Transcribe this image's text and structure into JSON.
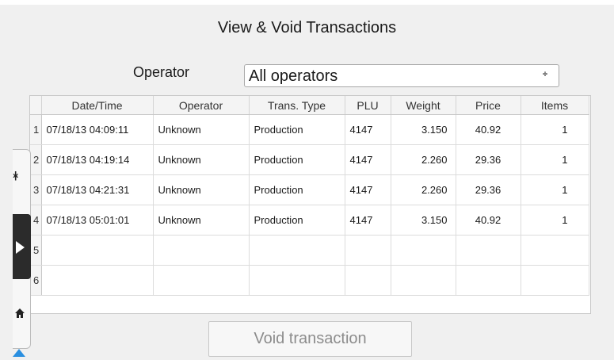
{
  "title": "View & Void Transactions",
  "operator_filter": {
    "label": "Operator",
    "selected": "All operators"
  },
  "table": {
    "columns": [
      "",
      "Date/Time",
      "Operator",
      "Trans. Type",
      "PLU",
      "Weight",
      "Price",
      "Items"
    ],
    "rows": [
      {
        "num": "1",
        "datetime": "07/18/13 04:09:11",
        "operator": "Unknown",
        "type": "Production",
        "plu": "4147",
        "weight": "3.150",
        "price": "40.92",
        "items": "1"
      },
      {
        "num": "2",
        "datetime": "07/18/13 04:19:14",
        "operator": "Unknown",
        "type": "Production",
        "plu": "4147",
        "weight": "2.260",
        "price": "29.36",
        "items": "1"
      },
      {
        "num": "3",
        "datetime": "07/18/13 04:21:31",
        "operator": "Unknown",
        "type": "Production",
        "plu": "4147",
        "weight": "2.260",
        "price": "29.36",
        "items": "1"
      },
      {
        "num": "4",
        "datetime": "07/18/13 05:01:01",
        "operator": "Unknown",
        "type": "Production",
        "plu": "4147",
        "weight": "3.150",
        "price": "40.92",
        "items": "1"
      },
      {
        "num": "5",
        "datetime": "",
        "operator": "",
        "type": "",
        "plu": "",
        "weight": "",
        "price": "",
        "items": ""
      },
      {
        "num": "6",
        "datetime": "",
        "operator": "",
        "type": "",
        "plu": "",
        "weight": "",
        "price": "",
        "items": ""
      }
    ]
  },
  "void_button": {
    "label": "Void transaction",
    "enabled": false
  },
  "side_toolbar": {
    "icons": [
      "fit-view-icon",
      "play-icon",
      "home-icon",
      "up-arrow-icon"
    ],
    "colors": {
      "dark": "#2b2b2b",
      "accent": "#2a8fe0"
    }
  },
  "arrows_glyph": "÷"
}
